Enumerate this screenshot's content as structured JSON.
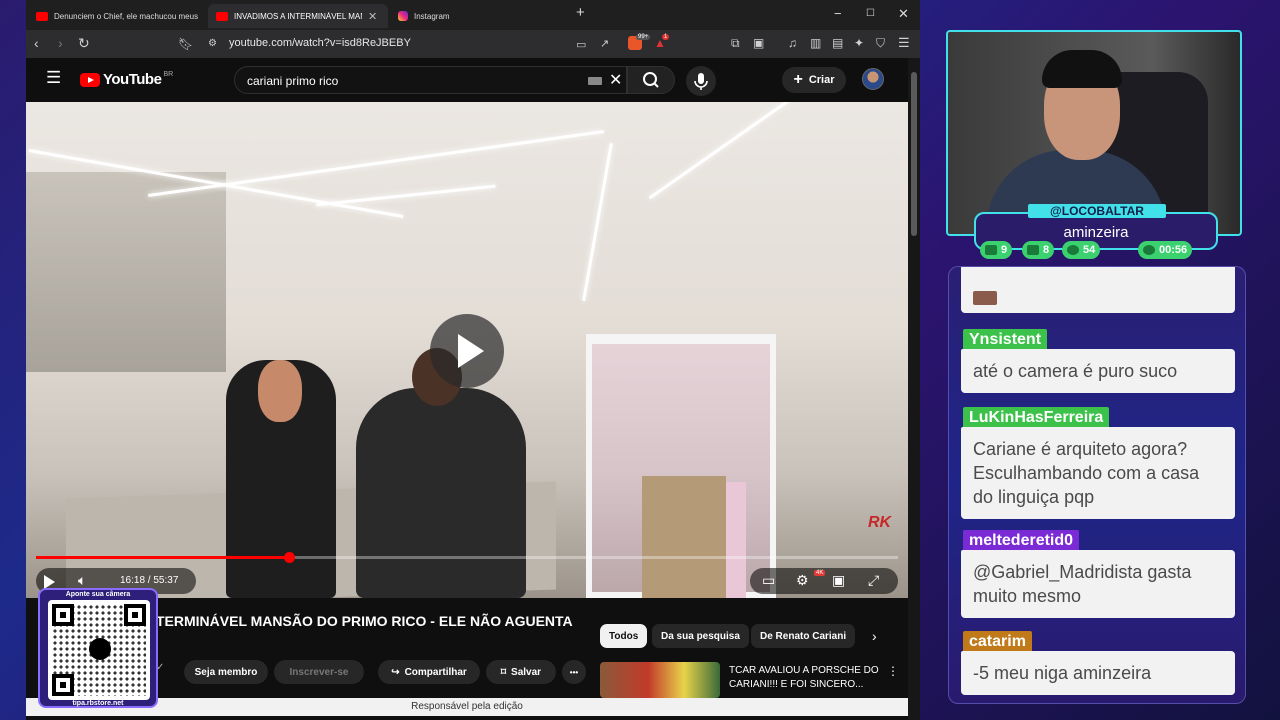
{
  "browser": {
    "tabs": [
      {
        "label": "Denunciem o Chief, ele machucou meus sen",
        "icon": "youtube-icon",
        "active": false
      },
      {
        "label": "INVADIMOS A INTERMINÁVEL MANSÃ",
        "icon": "youtube-icon",
        "active": true
      },
      {
        "label": "Instagram",
        "icon": "instagram-icon",
        "active": false
      }
    ],
    "new_tab": "+",
    "window_controls": [
      "−",
      "☐",
      "✕"
    ],
    "url": "youtube.com/watch?v=isd8ReJBEBY",
    "brave_badge": "99+",
    "alert_badge": "1"
  },
  "youtube": {
    "logo": "YouTube",
    "country": "BR",
    "search_value": "cariani primo rico",
    "create_label": "Criar",
    "video": {
      "watermark": "RK",
      "current_time": "16:18",
      "duration": "55:37",
      "time_display": "16:18 / 55:37",
      "progress": 0.293,
      "quality_badge": "4K"
    },
    "title": "TERMINÁVEL MANSÃO DO PRIMO RICO - ELE NÃO AGUENTA",
    "verified": "✓",
    "member_label": "Seja membro",
    "subscribe_label": "Inscrever-se",
    "share_label": "Compartilhar",
    "save_label": "Salvar",
    "more": "•••",
    "chips": [
      "Todos",
      "Da sua pesquisa",
      "De Renato Cariani"
    ],
    "chip_next": "›",
    "suggestion_title": "TCAR AVALIOU A PORSCHE DO CARIANI!!! E FOI SINCERO...",
    "suggestion_more": "⋮",
    "status": "Responsável pela edição"
  },
  "overlay": {
    "qr_top": "Aponte sua câmera",
    "qr_bottom": "tipa.rbstore.net"
  },
  "stream": {
    "handle": "@LOCOBALTAR",
    "name": "aminzeira",
    "stats": [
      {
        "icon": "twitch-icon",
        "value": "9"
      },
      {
        "icon": "youtube-icon",
        "value": "8"
      },
      {
        "icon": "kick-icon",
        "value": "54"
      },
      {
        "icon": "clock-icon",
        "value": "00:56"
      }
    ],
    "accent": "#42e0e8"
  },
  "chat": {
    "messages": [
      {
        "user": "Ynsistent",
        "color": "#3cc24a",
        "text": "até o camera é puro suco"
      },
      {
        "user": "LuKinHasFerreira",
        "color": "#3cc24a",
        "text": "Cariane é arquiteto agora? Esculhambando com a casa do linguiça pqp"
      },
      {
        "user": "meltederetid0",
        "color": "#7a2bd6",
        "text": "@Gabriel_Madridista gasta muito mesmo"
      },
      {
        "user": "catarim",
        "color": "#c07a1a",
        "text": "-5 meu niga aminzeira"
      }
    ]
  }
}
